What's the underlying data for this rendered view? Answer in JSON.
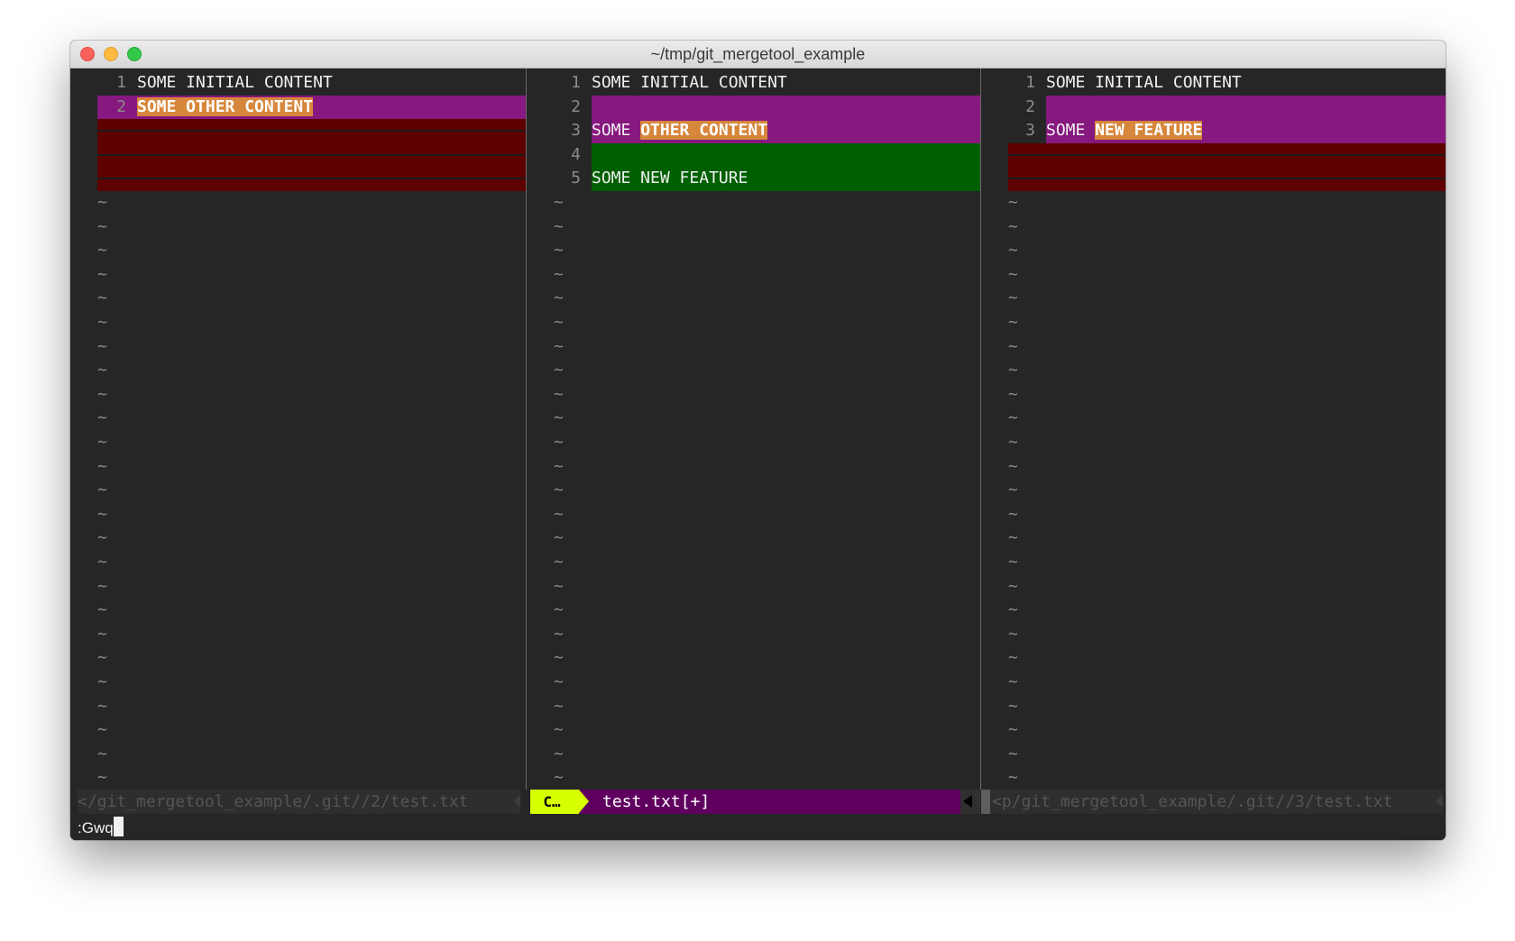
{
  "window": {
    "title": "~/tmp/git_mergetool_example"
  },
  "panes": [
    {
      "id": "local",
      "lines": [
        {
          "num": "1",
          "segments": [
            {
              "text": "SOME INITIAL CONTENT",
              "hl": false
            }
          ],
          "bg": "none"
        },
        {
          "num": "2",
          "segments": [
            {
              "text": "SOME OTHER CONTENT",
              "hl": true
            }
          ],
          "bg": "change"
        },
        {
          "num": "",
          "segments": [],
          "bg": "del"
        },
        {
          "num": "",
          "segments": [],
          "bg": "del"
        },
        {
          "num": "",
          "segments": [],
          "bg": "del"
        }
      ],
      "status": "</git_mergetool_example/.git//2/test.txt"
    },
    {
      "id": "merged",
      "lines": [
        {
          "num": "1",
          "segments": [
            {
              "text": "SOME INITIAL CONTENT",
              "hl": false
            }
          ],
          "bg": "none"
        },
        {
          "num": "2",
          "segments": [],
          "bg": "change"
        },
        {
          "num": "3",
          "segments": [
            {
              "text": "SOME ",
              "hl": false
            },
            {
              "text": "OTHER CONTENT",
              "hl": true
            }
          ],
          "bg": "change"
        },
        {
          "num": "4",
          "segments": [],
          "bg": "add"
        },
        {
          "num": "5",
          "segments": [
            {
              "text": "SOME NEW FEATURE",
              "hl": false
            }
          ],
          "bg": "add"
        }
      ],
      "status_mode": "C…",
      "status": "test.txt[+]"
    },
    {
      "id": "remote",
      "lines": [
        {
          "num": "1",
          "segments": [
            {
              "text": "SOME INITIAL CONTENT",
              "hl": false
            }
          ],
          "bg": "none"
        },
        {
          "num": "2",
          "segments": [],
          "bg": "change"
        },
        {
          "num": "3",
          "segments": [
            {
              "text": "SOME ",
              "hl": false
            },
            {
              "text": "NEW FEATURE",
              "hl": true
            }
          ],
          "bg": "change"
        },
        {
          "num": "",
          "segments": [],
          "bg": "del"
        },
        {
          "num": "",
          "segments": [],
          "bg": "del"
        }
      ],
      "status": "<p/git_mergetool_example/.git//3/test.txt"
    }
  ],
  "filler": "~",
  "cmdline": ":Gwq",
  "colors": {
    "change": "#87187f",
    "add": "#005f00",
    "delete": "#5f0000",
    "text_highlight": "#d7873c",
    "mode_badge": "#d7ff00"
  }
}
